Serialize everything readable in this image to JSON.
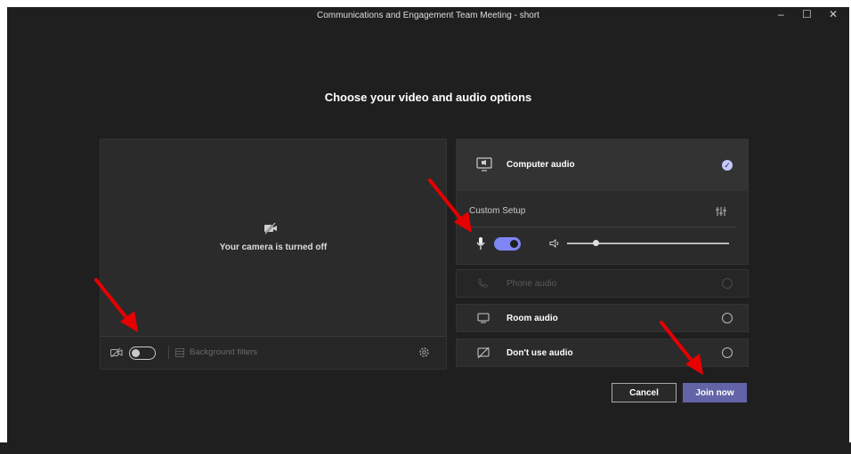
{
  "window": {
    "title": "Communications and Engagement Team Meeting - short",
    "controls": {
      "minimize": "–",
      "maximize": "☐",
      "close": "✕"
    }
  },
  "heading": "Choose your video and audio options",
  "video": {
    "camera_off_text": "Your camera is turned off",
    "camera_toggle_on": false,
    "background_filters_label": "Background filters"
  },
  "audio": {
    "computer_audio": {
      "label": "Computer audio",
      "selected": true
    },
    "custom_setup_label": "Custom Setup",
    "mic_on": true,
    "speaker_volume_percent": 18,
    "phone_audio": {
      "label": "Phone audio",
      "disabled": true
    },
    "room_audio": {
      "label": "Room audio"
    },
    "no_audio": {
      "label": "Don't use audio"
    }
  },
  "buttons": {
    "cancel": "Cancel",
    "join": "Join now"
  },
  "colors": {
    "accent": "#6264a7",
    "toggle_on": "#7f85f5",
    "background": "#1f1f1f",
    "annotation_arrow": "#e60000"
  },
  "icons": [
    "camera-off-icon",
    "settings-icon",
    "computer-audio-icon",
    "equalizer-icon",
    "microphone-icon",
    "speaker-icon",
    "phone-icon",
    "room-icon",
    "no-audio-icon"
  ]
}
